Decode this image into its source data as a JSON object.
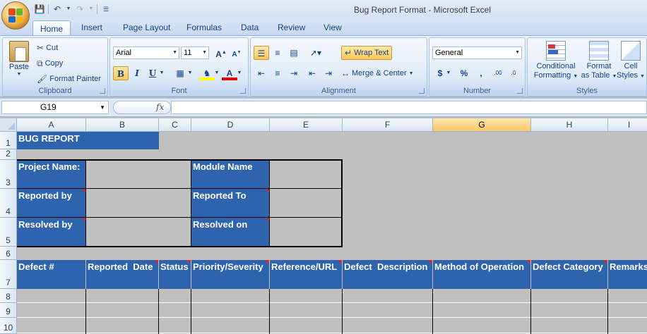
{
  "window": {
    "title": "Bug Report Format - Microsoft Excel"
  },
  "tabs": [
    "Home",
    "Insert",
    "Page Layout",
    "Formulas",
    "Data",
    "Review",
    "View"
  ],
  "ribbon": {
    "clipboard": {
      "label": "Clipboard",
      "paste": "Paste",
      "cut": "Cut",
      "copy": "Copy",
      "format_painter": "Format Painter"
    },
    "font": {
      "label": "Font",
      "name": "Arial",
      "size": "11"
    },
    "alignment": {
      "label": "Alignment",
      "wrap_text": "Wrap Text",
      "merge_center": "Merge & Center"
    },
    "number": {
      "label": "Number",
      "format": "General"
    },
    "styles": {
      "label": "Styles",
      "conditional_1": "Conditional",
      "conditional_2": "Formatting",
      "format_table_1": "Format",
      "format_table_2": "as Table",
      "cell_styles_1": "Cell",
      "cell_styles_2": "Styles"
    }
  },
  "formula_bar": {
    "name_box": "G19",
    "fx": "fx",
    "formula": ""
  },
  "columns": [
    "A",
    "B",
    "C",
    "D",
    "E",
    "F",
    "G",
    "H",
    "I"
  ],
  "selected_column": "G",
  "rows": [
    "1",
    "2",
    "3",
    "4",
    "5",
    "6",
    "7",
    "8",
    "9",
    "10"
  ],
  "sheet": {
    "title": "BUG REPORT",
    "project_name": "Project Name:",
    "module_name": "Module Name",
    "reported_by": "Reported by",
    "reported_to": "Reported To",
    "resolved_by": "Resolved by",
    "resolved_on": "Resolved on",
    "headers": [
      "Defect #",
      "Reported  Date",
      "Status",
      "Priority/Severity",
      "Reference/URL",
      "Defect  Description",
      "Method of Operation",
      "Defect Category",
      "Remarks"
    ]
  },
  "colors": {
    "header_blue": "#2e63ae",
    "sheet_gray": "#c0c0c0",
    "comment_red": "#d8262e"
  }
}
